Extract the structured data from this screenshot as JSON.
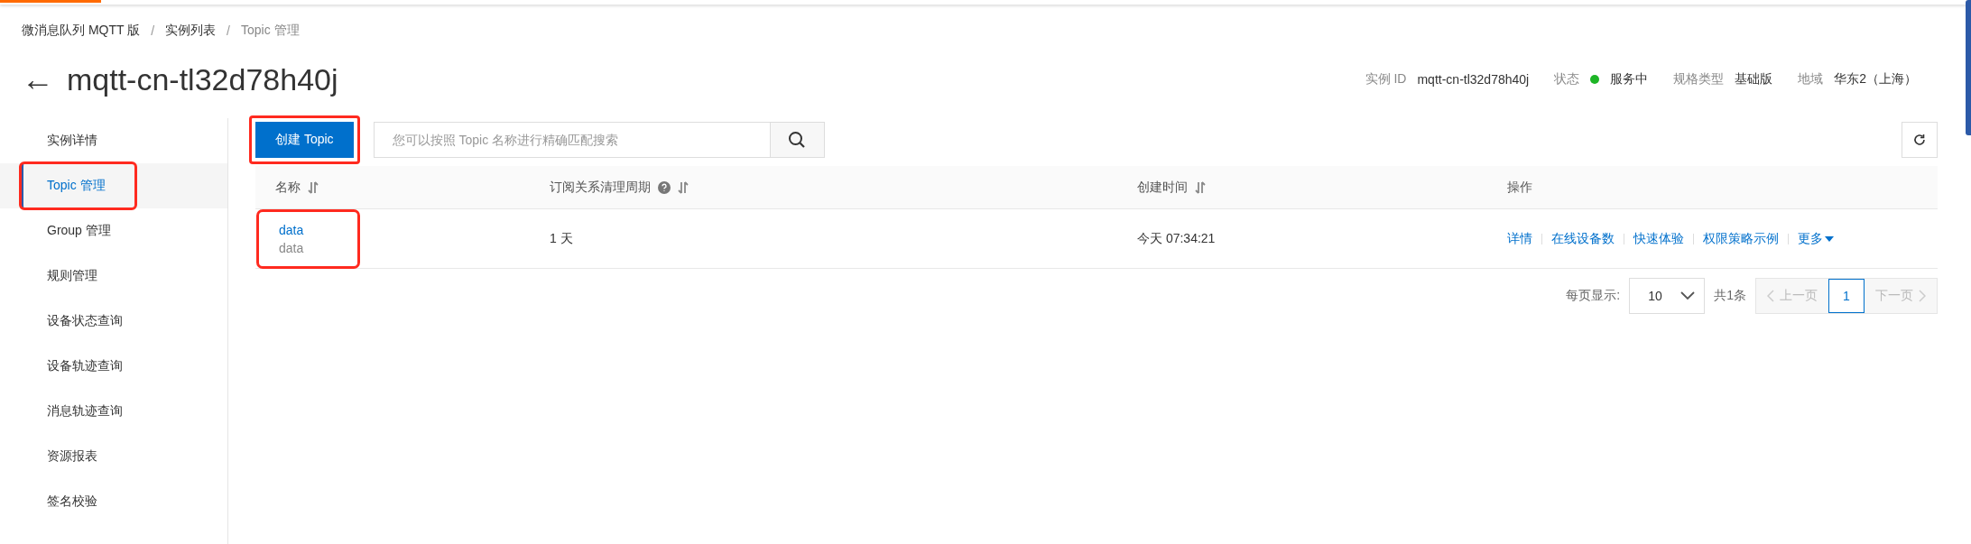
{
  "breadcrumb": {
    "separator": "/",
    "items": [
      "微消息队列 MQTT 版",
      "实例列表",
      "Topic 管理"
    ]
  },
  "title": {
    "back_icon": "←",
    "text": "mqtt-cn-tl32d78h40j"
  },
  "info": [
    {
      "label": "实例 ID",
      "value": "mqtt-cn-tl32d78h40j"
    },
    {
      "label": "状态",
      "value": "服务中",
      "color": "#1db526"
    },
    {
      "label": "规格类型",
      "value": "基础版"
    },
    {
      "label": "地域",
      "value": "华东2（上海）"
    }
  ],
  "sidebar": {
    "items": [
      {
        "label": "实例详情",
        "selected": false,
        "highlighted": false
      },
      {
        "label": "Topic 管理",
        "selected": true,
        "highlighted": true
      },
      {
        "label": "Group 管理",
        "selected": false,
        "highlighted": false
      },
      {
        "label": "规则管理",
        "selected": false,
        "highlighted": false
      },
      {
        "label": "设备状态查询",
        "selected": false,
        "highlighted": false
      },
      {
        "label": "设备轨迹查询",
        "selected": false,
        "highlighted": false
      },
      {
        "label": "消息轨迹查询",
        "selected": false,
        "highlighted": false
      },
      {
        "label": "资源报表",
        "selected": false,
        "highlighted": false
      },
      {
        "label": "签名校验",
        "selected": false,
        "highlighted": false
      }
    ]
  },
  "toolbar": {
    "create_button": {
      "label": "创建 Topic",
      "highlighted": true
    },
    "search": {
      "placeholder": "您可以按照 Topic 名称进行精确匹配搜索"
    }
  },
  "table": {
    "columns": [
      {
        "label": "名称",
        "sortable": true,
        "help": false
      },
      {
        "label": "订阅关系清理周期",
        "sortable": true,
        "help": true
      },
      {
        "label": "创建时间",
        "sortable": true,
        "help": false
      },
      {
        "label": "操作",
        "sortable": false,
        "help": false
      }
    ],
    "rows": [
      {
        "name": "data",
        "description": "data",
        "highlighted": true,
        "period": "1 天",
        "created": "今天 07:34:21",
        "actions": [
          "详情",
          "在线设备数",
          "快速体验",
          "权限策略示例"
        ],
        "more": "更多"
      }
    ]
  },
  "pagination": {
    "page_size_label": "每页显示:",
    "page_size": "10",
    "total": "共1条",
    "prev": "上一页",
    "pages": [
      {
        "label": "1",
        "selected": true
      }
    ],
    "next": "下一页"
  }
}
